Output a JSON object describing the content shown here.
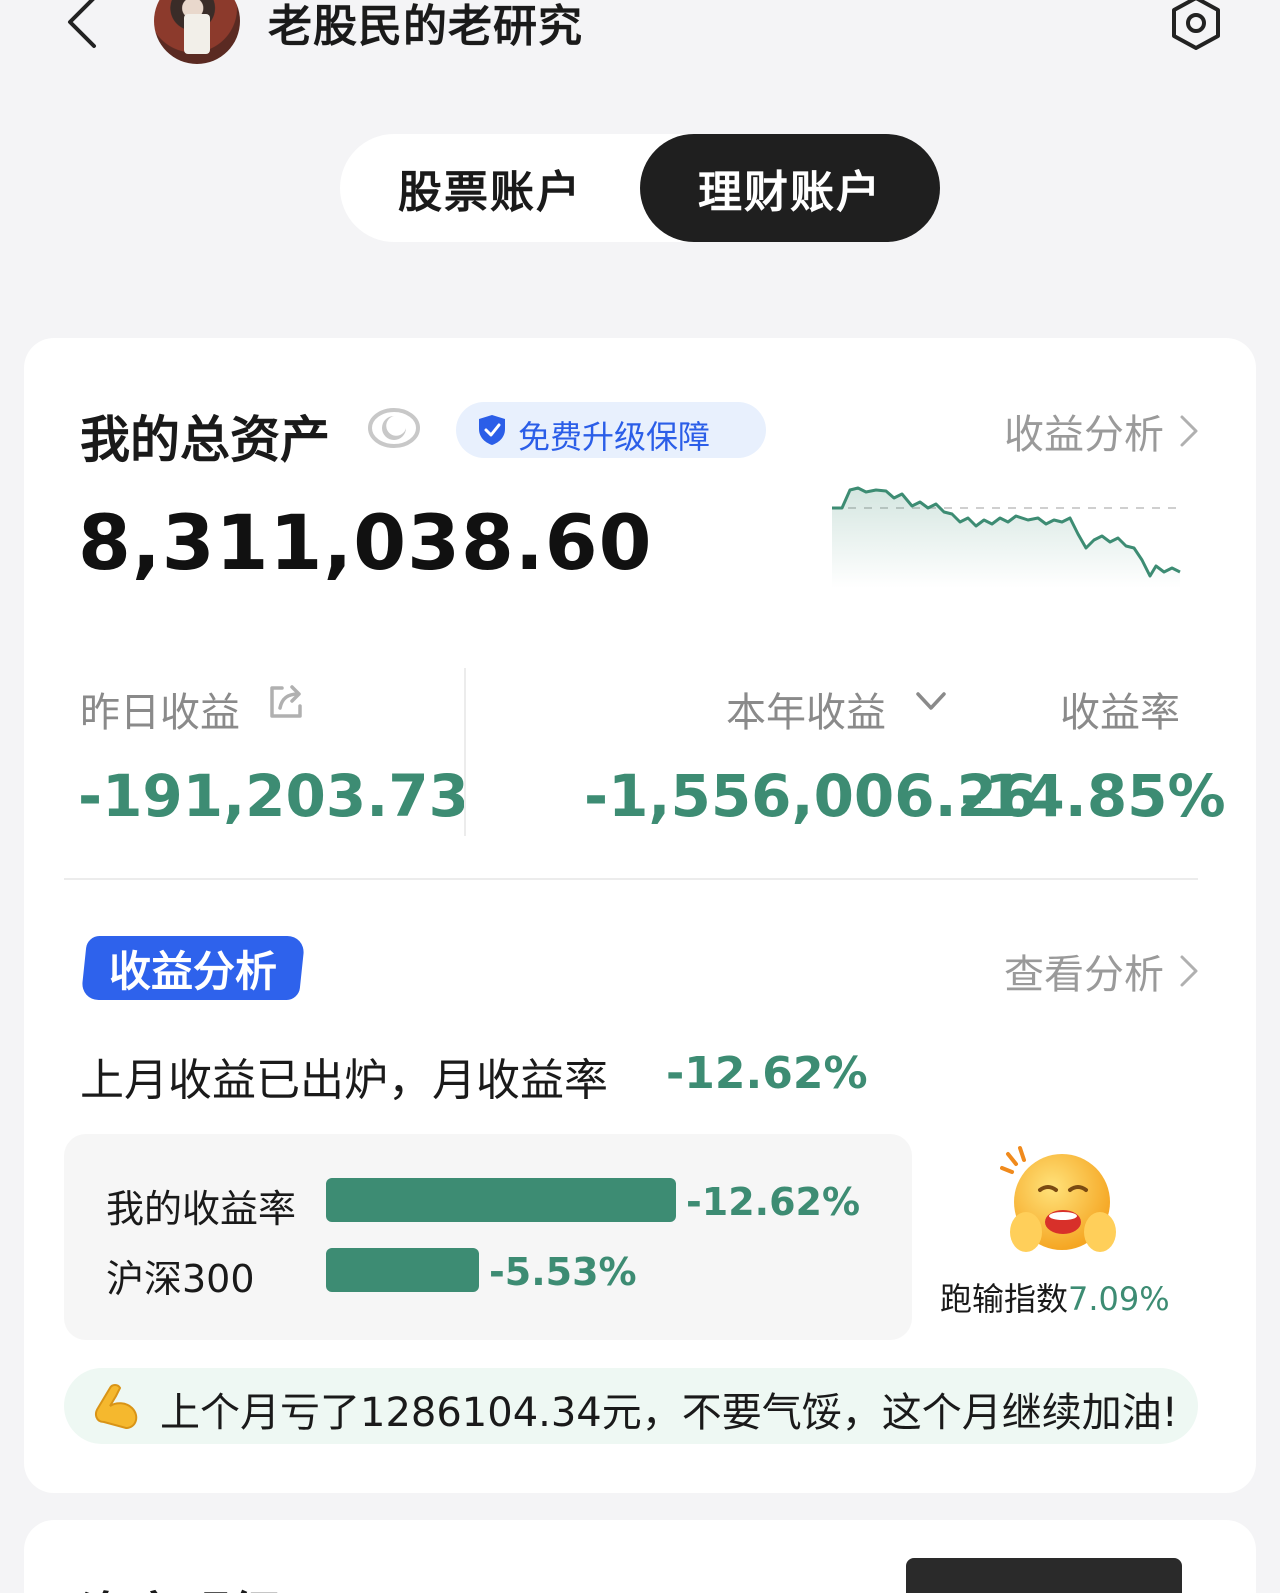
{
  "header": {
    "title": "老股民的老研究"
  },
  "tabs": {
    "stock": "股票账户",
    "wealth": "理财账户",
    "active": "wealth"
  },
  "assets": {
    "title": "我的总资产",
    "badge": "免费升级保障",
    "analysis_link": "收益分析",
    "total": "8,311,038.60"
  },
  "stats": {
    "yesterday_label": "昨日收益",
    "yesterday_value": "-191,203.73",
    "year_label": "本年收益",
    "year_value": "-1,556,006.26",
    "rate_label": "收益率",
    "rate_value": "-14.85%"
  },
  "analysis": {
    "tag": "收益分析",
    "view_link": "查看分析",
    "month_line": "上月收益已出炉，月收益率",
    "month_rate": "-12.62%",
    "compare": [
      {
        "label": "我的收益率",
        "value": "-12.62%",
        "magnitude": 12.62
      },
      {
        "label": "沪深300",
        "value": "-5.53%",
        "magnitude": 5.53
      }
    ],
    "lose_index_label": "跑输指数",
    "lose_index_value": "7.09%"
  },
  "tip": {
    "text": "上个月亏了1286104.34元，不要气馁，这个月继续加油!"
  },
  "next_section": {
    "title": "资产明细"
  },
  "colors": {
    "loss_green": "#3d8c73",
    "accent_blue": "#2e62ec",
    "tab_dark": "#1f1f1f"
  }
}
